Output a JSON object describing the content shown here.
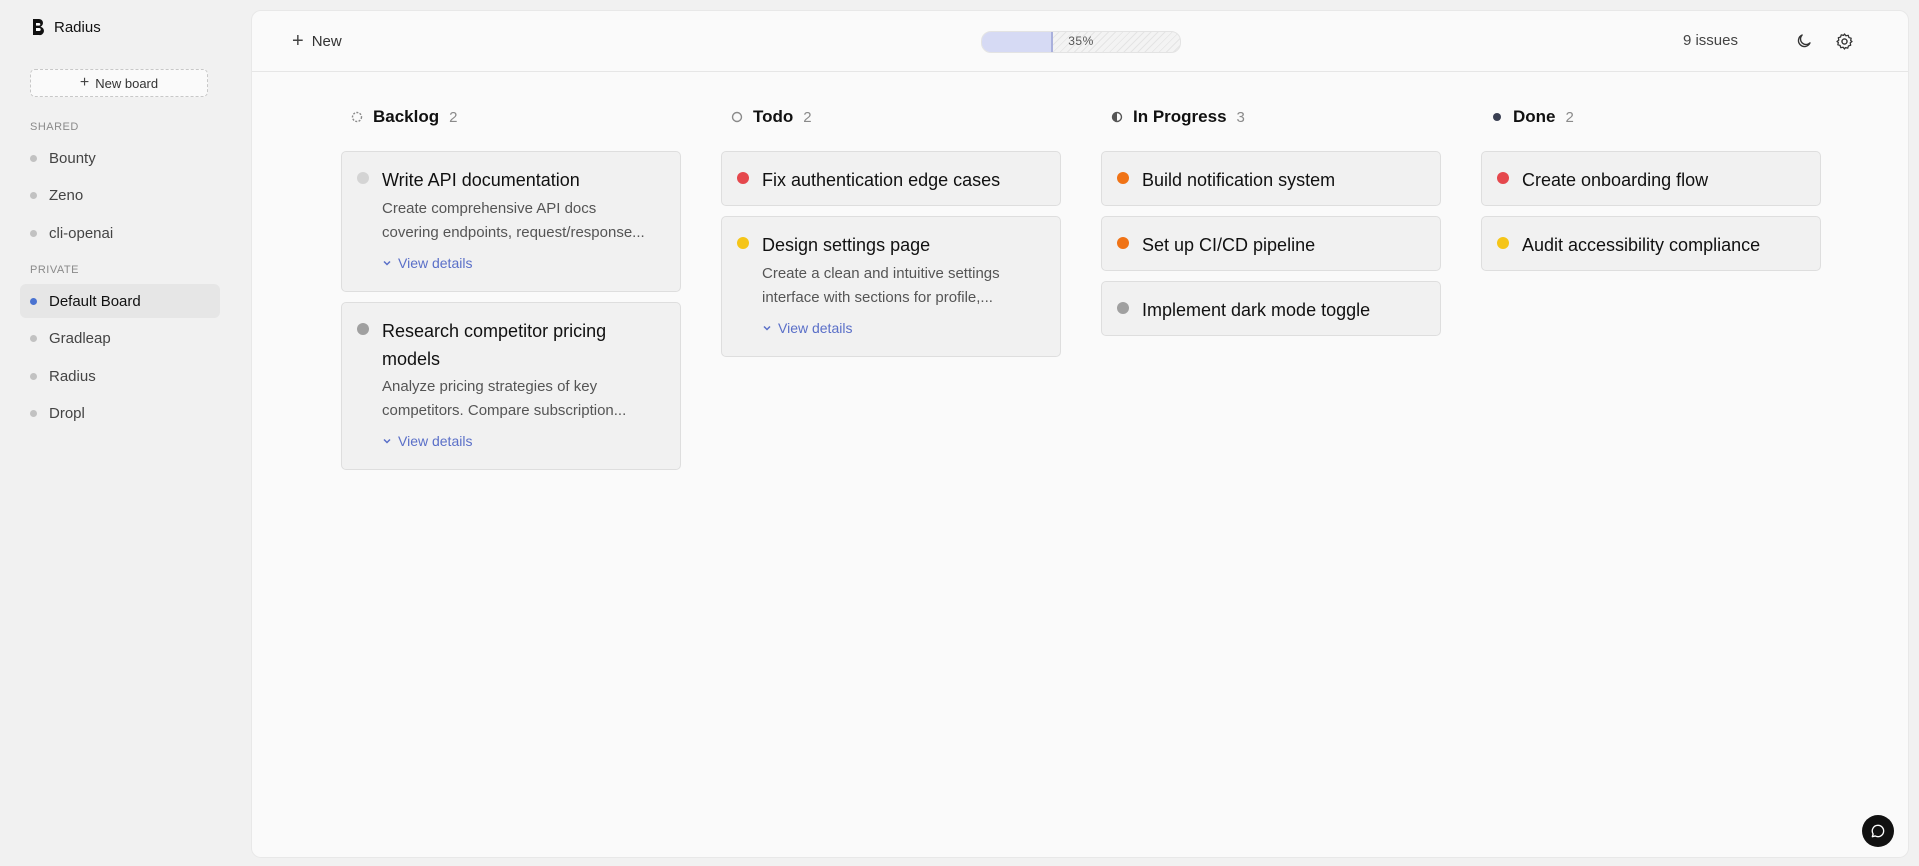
{
  "sidebar": {
    "brand": "Radius",
    "new_board_label": "New board",
    "shared_label": "SHARED",
    "private_label": "PRIVATE",
    "shared_boards": [
      "Bounty",
      "Zeno",
      "cli-openai"
    ],
    "private_boards": [
      "Default Board",
      "Gradleap",
      "Radius",
      "Dropl"
    ],
    "active_board": "Default Board"
  },
  "topbar": {
    "new_label": "New",
    "progress_text": "35%",
    "progress_value": 0.35,
    "issues_label": "9 issues"
  },
  "colors": {
    "priority_urgent": "#e5484d",
    "priority_high": "#f07316",
    "priority_medium": "#f5c518",
    "priority_low": "#a0a0a0",
    "priority_none": "#d4d4d4",
    "accent": "#5a6fc8"
  },
  "columns": [
    {
      "title": "Backlog",
      "count": "2",
      "status_icon": "backlog-dashed-circle-icon",
      "cards": [
        {
          "title": "Write API documentation",
          "priority_color": "#d4d4d4",
          "desc": [
            "Create comprehensive API docs",
            "covering endpoints, request/response..."
          ],
          "details": "View details"
        },
        {
          "title": "Research competitor pricing models",
          "priority_color": "#a0a0a0",
          "desc": [
            "Analyze pricing strategies of key",
            "competitors. Compare subscription..."
          ],
          "details": "View details"
        }
      ]
    },
    {
      "title": "Todo",
      "count": "2",
      "status_icon": "todo-circle-icon",
      "cards": [
        {
          "title": "Fix authentication edge cases",
          "priority_color": "#e5484d"
        },
        {
          "title": "Design settings page",
          "priority_color": "#f5c518",
          "desc": [
            "Create a clean and intuitive settings",
            "interface with sections for profile,..."
          ],
          "details": "View details"
        }
      ]
    },
    {
      "title": "In Progress",
      "count": "3",
      "status_icon": "in-progress-half-circle-icon",
      "cards": [
        {
          "title": "Build notification system",
          "priority_color": "#f07316"
        },
        {
          "title": "Set up CI/CD pipeline",
          "priority_color": "#f07316"
        },
        {
          "title": "Implement dark mode toggle",
          "priority_color": "#a0a0a0"
        }
      ]
    },
    {
      "title": "Done",
      "count": "2",
      "status_icon": "done-filled-circle-icon",
      "cards": [
        {
          "title": "Create onboarding flow",
          "priority_color": "#e5484d"
        },
        {
          "title": "Audit accessibility compliance",
          "priority_color": "#f5c518"
        }
      ]
    }
  ]
}
